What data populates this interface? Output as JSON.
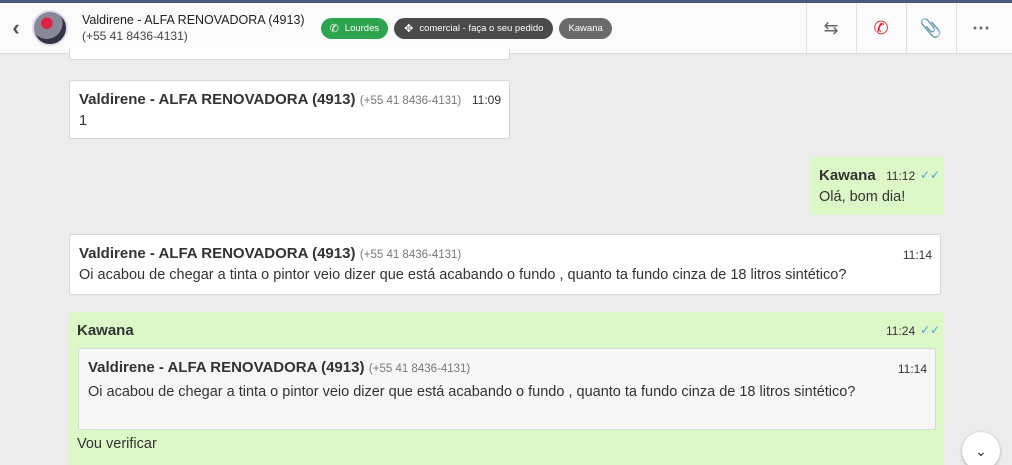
{
  "header": {
    "contact_name": "Valdirene - ALFA RENOVADORA (4913)",
    "contact_phone": "(+55 41 8436-4131)",
    "tags": [
      {
        "label": "Lourdes",
        "color": "#2ea44f"
      },
      {
        "label": "comercial - faça o seu pedido",
        "color": "#4a4a4a"
      },
      {
        "label": "Kawana",
        "color": "#6a6a6a"
      }
    ]
  },
  "messages": [
    {
      "author": "Valdirene - ALFA RENOVADORA (4913)",
      "phone": "(+55 41 8436-4131)",
      "time": "11:09",
      "text": "1"
    },
    {
      "author": "Kawana",
      "time": "11:12",
      "text": "Olá, bom dia!"
    },
    {
      "author": "Valdirene - ALFA RENOVADORA (4913)",
      "phone": "(+55 41 8436-4131)",
      "time": "11:14",
      "text": "Oi acabou de chegar a tinta o pintor veio dizer que está acabando o fundo , quanto ta fundo cinza de 18 litros sintético?"
    },
    {
      "author": "Kawana",
      "time": "11:24",
      "quote": {
        "author": "Valdirene - ALFA RENOVADORA (4913)",
        "phone": "(+55 41 8436-4131)",
        "time": "11:14",
        "text": "Oi acabou de chegar a tinta o pintor veio dizer que está acabando o fundo , quanto ta fundo cinza de 18 litros sintético?"
      },
      "text": "Vou verificar"
    }
  ],
  "colors": {
    "incoming": "#ffffff",
    "outgoing": "#dcf8c6",
    "read_ticks": "#4fa3e0"
  }
}
